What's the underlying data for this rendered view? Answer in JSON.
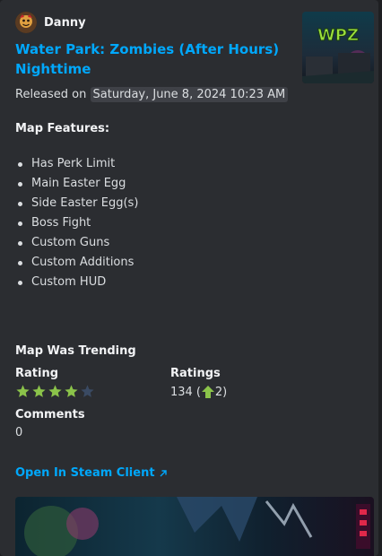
{
  "author": {
    "name": "Danny",
    "avatar_icon": "avatar-icon"
  },
  "title": "Water Park: Zombies (After Hours) Nighttime",
  "released": {
    "prefix": "Released on",
    "timestamp": "Saturday, June 8, 2024 10:23 AM"
  },
  "thumbnail": {
    "logo_text": "WPZ"
  },
  "features": {
    "heading": "Map Features:",
    "items": [
      "Has Perk Limit",
      "Main Easter Egg",
      "Side Easter Egg(s)",
      "Boss Fight",
      "Custom Guns",
      "Custom Additions",
      "Custom HUD"
    ]
  },
  "trending": "Map Was Trending",
  "rating": {
    "label": "Rating",
    "stars_filled": 4,
    "stars_total": 5,
    "star_color": "#8bc34a"
  },
  "ratings": {
    "label": "Ratings",
    "count": "134",
    "open_paren": "(",
    "up_count": "2)",
    "up_icon": "arrow-up-icon"
  },
  "comments": {
    "label": "Comments",
    "value": "0"
  },
  "link": {
    "label": "Open In Steam Client",
    "icon": "external-link-icon"
  },
  "colors": {
    "accent": "#00a8fc",
    "background": "#2b2d31"
  }
}
